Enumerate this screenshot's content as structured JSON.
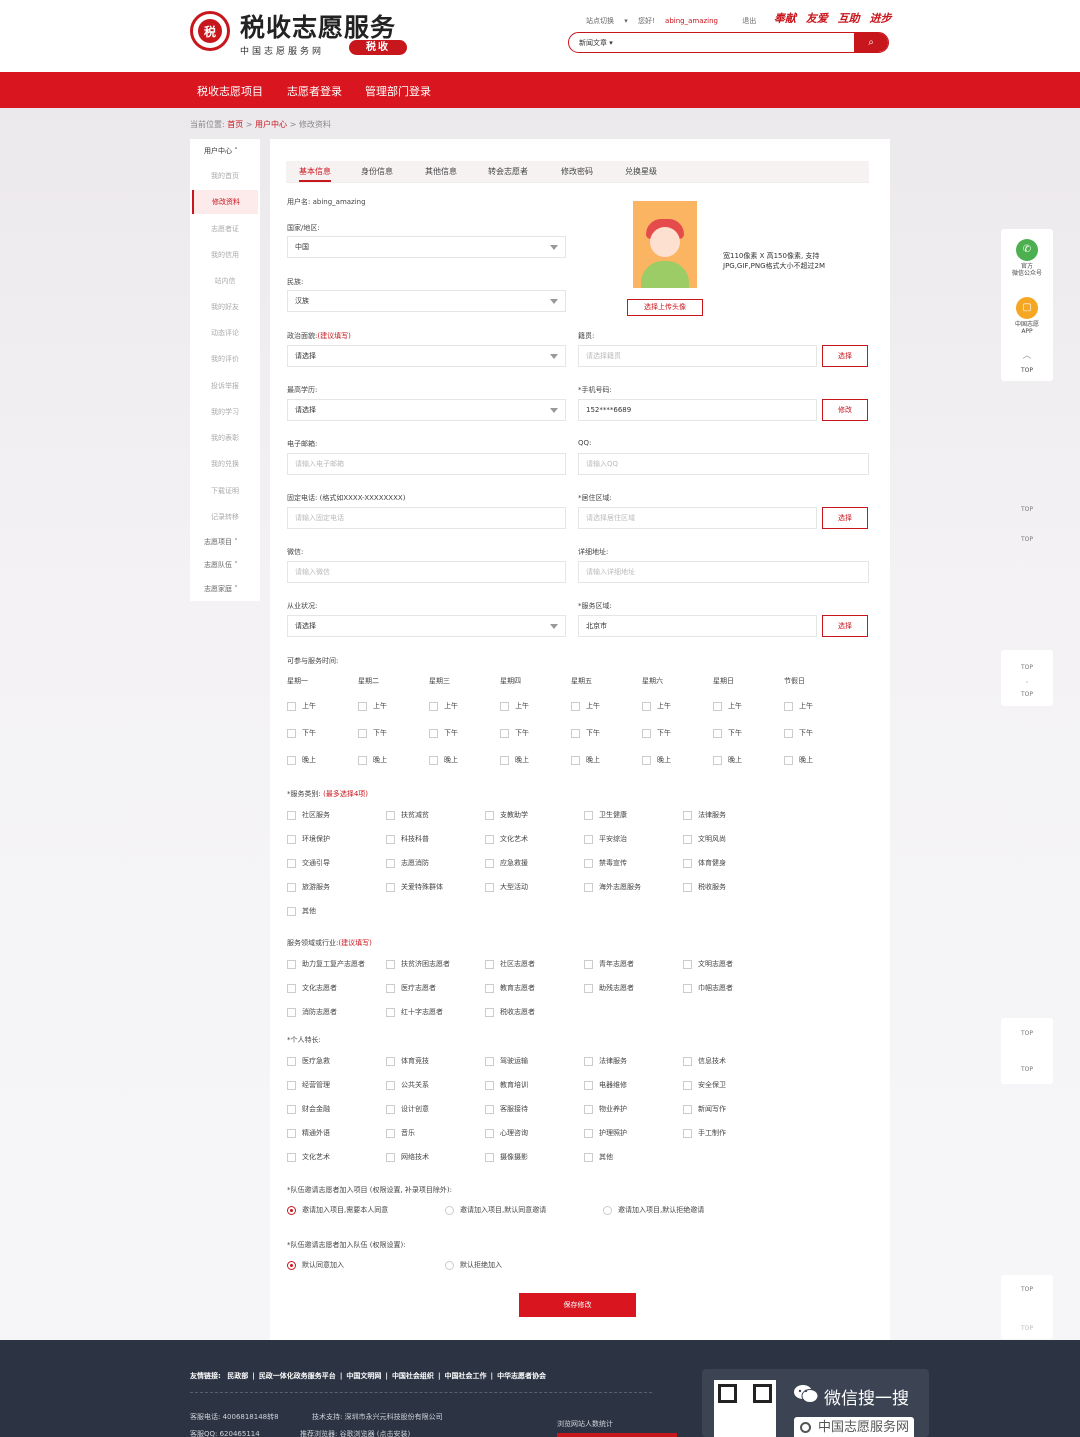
{
  "header": {
    "site_title": "税收志愿服务",
    "site_subtitle": "中国志愿服务网",
    "badge": "税收",
    "site_switch": "站点切换",
    "greeting": "您好!",
    "username": "abing_amazing",
    "logout": "退出",
    "slogan": [
      "奉献",
      "友爱",
      "互助",
      "进步"
    ],
    "search": {
      "category": "新闻文章 ▾",
      "placeholder": ""
    }
  },
  "nav": [
    "税收志愿项目",
    "志愿者登录",
    "管理部门登录"
  ],
  "breadcrumb": {
    "prefix": "当前位置:",
    "home": "首页",
    "sep": ">",
    "center": "用户中心",
    "current": "修改资料"
  },
  "sidebar": {
    "head": "用户中心 ˄",
    "items": [
      "我的首页",
      "修改资料",
      "志愿者证",
      "我的信用",
      "站内信",
      "我的好友",
      "动态评论",
      "我的评价",
      "投诉举报",
      "我的学习",
      "我的表彰",
      "我的兑换",
      "下载证明",
      "记录转移"
    ],
    "groups": [
      "志愿项目 ˅",
      "志愿队伍 ˅",
      "志愿家庭 ˅"
    ]
  },
  "tabs": [
    "基本信息",
    "身份信息",
    "其他信息",
    "转会志愿者",
    "修改密码",
    "兑换星级"
  ],
  "form": {
    "username_label": "用户名:",
    "username_value": "abing_amazing",
    "country_label": "国家/地区:",
    "country_value": "中国",
    "ethnic_label": "民族:",
    "ethnic_value": "汉族",
    "political_label": "政治面貌:",
    "suggest_hint": "(建议填写)",
    "select_placeholder": "请选择",
    "native_label": "籍贯:",
    "native_placeholder": "请选择籍贯",
    "edu_label": "最高学历:",
    "phone_label": "*手机号码:",
    "phone_value": "152****6689",
    "email_label": "电子邮箱:",
    "email_placeholder": "请输入电子邮箱",
    "qq_label": "QQ:",
    "qq_placeholder": "请输入QQ",
    "tel_label": "固定电话: (格式如XXXX-XXXXXXXX)",
    "tel_placeholder": "请输入固定电话",
    "residence_label": "*居住区域:",
    "residence_placeholder": "请选择居住区域",
    "wechat_label": "微信:",
    "wechat_placeholder": "请输入微信",
    "address_label": "详细地址:",
    "address_placeholder": "请输入详细地址",
    "job_label": "从业状况:",
    "service_area_label": "*服务区域:",
    "service_area_value": "北京市",
    "btn_choose": "选择",
    "btn_modify": "修改",
    "upload_btn": "选择上传头像",
    "upload_hint": "宽110像素 X 高150像素, 支持JPG,GIF,PNG格式大小不超过2M"
  },
  "time": {
    "label": "可参与服务时间:",
    "days": [
      "星期一",
      "星期二",
      "星期三",
      "星期四",
      "星期五",
      "星期六",
      "星期日",
      "节假日"
    ],
    "slots": [
      "上午",
      "下午",
      "晚上"
    ]
  },
  "service_types": {
    "label": "*服务类别:",
    "hint": "(最多选择4项)",
    "items": [
      "社区服务",
      "扶贫减贫",
      "支教助学",
      "卫生健康",
      "法律服务",
      "环境保护",
      "科技科普",
      "文化艺术",
      "平安综治",
      "文明风尚",
      "交通引导",
      "志愿消防",
      "应急救援",
      "禁毒宣传",
      "体育健身",
      "旅游服务",
      "关爱特殊群体",
      "大型活动",
      "海外志愿服务",
      "税收服务",
      "其他"
    ]
  },
  "industry": {
    "label": "服务领域或行业:",
    "hint": "(建议填写)",
    "items": [
      "助力复工复产志愿者",
      "扶贫济困志愿者",
      "社区志愿者",
      "青年志愿者",
      "文明志愿者",
      "文化志愿者",
      "医疗志愿者",
      "教育志愿者",
      "助残志愿者",
      "巾帼志愿者",
      "消防志愿者",
      "红十字志愿者",
      "税收志愿者"
    ]
  },
  "skills": {
    "label": "*个人特长:",
    "items": [
      "医疗急救",
      "体育竞技",
      "驾驶运输",
      "法律服务",
      "信息技术",
      "经营管理",
      "公共关系",
      "教育培训",
      "电器维修",
      "安全保卫",
      "财会金融",
      "设计创意",
      "客服接待",
      "物业养护",
      "新闻写作",
      "精通外语",
      "音乐",
      "心理咨询",
      "护理照护",
      "手工制作",
      "文化艺术",
      "网络技术",
      "摄像摄影",
      "其他"
    ]
  },
  "invite_project": {
    "label": "*队伍邀请志愿者加入项目 (权限设置, 补录项目除外):",
    "options": [
      "邀请加入项目,需要本人同意",
      "邀请加入项目,默认同意邀请",
      "邀请加入项目,默认拒绝邀请"
    ]
  },
  "invite_team": {
    "label": "*队伍邀请志愿者加入队伍 (权限设置):",
    "options": [
      "默认同意加入",
      "默认拒绝加入"
    ]
  },
  "save_btn": "保存修改",
  "float": {
    "wechat": "官方\n微信公众号",
    "app": "中国志愿\nAPP",
    "top": "TOP"
  },
  "top_marks": [
    "TOP",
    "TOP",
    "TOP",
    "TOP",
    "TOP",
    "TOP",
    "TOP",
    "TOP",
    "TOP"
  ],
  "footer": {
    "links_label": "友情链接:",
    "links": [
      "民政部",
      "|",
      "民政一体化政务服务平台",
      "|",
      "中国文明网",
      "|",
      "中国社会组织",
      "|",
      "中国社会工作",
      "|",
      "中华志愿者协会"
    ],
    "hotline": "客服电话: 4006818148转8",
    "qq": "客服QQ: 620465114",
    "tech": "技术支持: 深圳市永兴元科技股份有限公司",
    "browser": "推荐浏览器: 谷歌浏览器 (点击安装)",
    "stats": "浏览网站人数统计",
    "wx_title": "微信搜一搜",
    "wx_search": "中国志愿服务网"
  },
  "colors": {
    "brand": "#c8161d",
    "nav": "#d9161f",
    "footer": "#2c3443"
  }
}
